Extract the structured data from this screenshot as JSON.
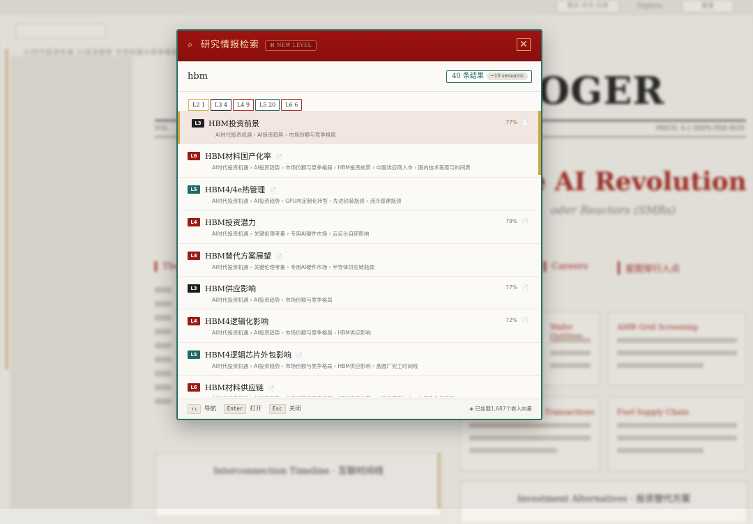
{
  "colors": {
    "header_red": "#9e1310",
    "accent_teal": "#2c6f63",
    "accent_gold": "#c9a642",
    "level_L3": "#1f1f1f",
    "level_L4": "#9b1b15",
    "level_L5": "#1f6b62",
    "level_L6": "#9b1b15"
  },
  "modal": {
    "header_icon": "search-icon",
    "title": "研究情报检索",
    "badge": "⌘ NEW LEVEL",
    "close_icon": "close-icon",
    "close_label": "✕"
  },
  "search": {
    "query": "hbm",
    "result_count": "40 条结果",
    "semantic_badge": "~10 semantic"
  },
  "filters": [
    {
      "label": "L2 1",
      "border": "#d8b24a"
    },
    {
      "label": "L3 4",
      "border": "#333333"
    },
    {
      "label": "L4 9",
      "border": "#b0302a"
    },
    {
      "label": "L5 20",
      "border": "#2c6f63"
    },
    {
      "label": "L6 6",
      "border": "#b0302a"
    }
  ],
  "results": [
    {
      "level": "L3",
      "title": "HBM投资前景",
      "path": "AI时代投资机遇 › AI投资趋势 › 市场份额与竞争格局",
      "score": "77%",
      "active": true
    },
    {
      "level": "L6",
      "title": "HBM材料国产化率",
      "path": "AI时代投资机遇 › AI投资趋势 › 市场份额与竞争格局 › HBM投资前景 › 中国供应商入市 › 国内技术差距与时间表",
      "score": ""
    },
    {
      "level": "L5",
      "title": "HBM4/4e热管理",
      "path": "AI时代投资机遇 › AI投资趋势 › GPU向定制化转型 › 先进封装瓶颈 › 液冷基建瓶颈",
      "score": ""
    },
    {
      "level": "L4",
      "title": "HBM投资潜力",
      "path": "AI时代投资机遇 › 关键伦理考量 › 专用AI硬件市场 › 云巨头自研影响",
      "score": "79%"
    },
    {
      "level": "L4",
      "title": "HBM替代方案展望",
      "path": "AI时代投资机遇 › 关键伦理考量 › 专用AI硬件市场 › 半导体供应链瓶颈",
      "score": ""
    },
    {
      "level": "L3",
      "title": "HBM供应影响",
      "path": "AI时代投资机遇 › AI投资趋势 › 市场份额与竞争格局",
      "score": "77%"
    },
    {
      "level": "L4",
      "title": "HBM4逻辑化影响",
      "path": "AI时代投资机遇 › AI投资趋势 › 市场份额与竞争格局 › HBM供应影响",
      "score": "72%"
    },
    {
      "level": "L5",
      "title": "HBM4逻辑芯片外包影响",
      "path": "AI时代投资机遇 › AI投资趋势 › 市场份额与竞争格局 › HBM供应影响 › 晶圆厂完工时间线",
      "score": ""
    },
    {
      "level": "L6",
      "title": "HBM材料供应链",
      "path": "AI时代投资机遇 › AI投资趋势 › 市场份额与竞争格局 › HBM投资前景 › 中国供应商入市 › 中国角色与资质",
      "score": ""
    }
  ],
  "footer": {
    "nav_key": "↑↓",
    "nav_label": "导航",
    "open_key": "Enter",
    "open_label": "打开",
    "close_key": "Esc",
    "close_label": "关闭",
    "status": "◈ 已加载1,687个嵌入向量"
  },
  "background": {
    "top_buttons": [
      "英文·中文·日本",
      "Explore",
      "登录"
    ],
    "breadcrumb": "AI时代投资机遇   AI投资趋势   市场份额与竞争格局",
    "masthead": "OGER",
    "headline": "e AI Revolution",
    "subheadline": "oder Reactors (SMRs)",
    "meta_left": "VOL",
    "meta_right": "PRICE: 0.1 NEPS PER RUN",
    "sections": [
      "The",
      "Careers",
      "星图穿行入点"
    ],
    "card_titles": [
      "Wafer Outlines",
      "AMR Grid Screening",
      "Transactions",
      "Fuel Supply Chain"
    ],
    "panel_title_left": "Interconnection Timeline · 互联时间线",
    "panel_title_right": "Investment Alternatives · 投资替代方案"
  }
}
